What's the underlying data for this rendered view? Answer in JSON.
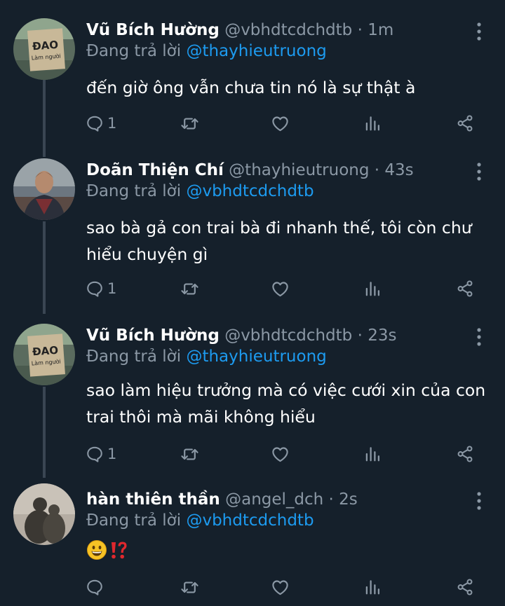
{
  "tweets": [
    {
      "name": "Vũ Bích Hường",
      "handle": "@vbhdtcdchdtb",
      "separator": "·",
      "time": "1m",
      "replying_label": "Đang trả lời",
      "replying_to": "@thayhieutruong",
      "text": "đến giờ ông vẫn chưa tin nó là sự thật à",
      "reply_count": "1",
      "avatar_sign_line1": "ĐAO",
      "avatar_sign_line2": "Làm người"
    },
    {
      "name": "Doãn Thiện Chí",
      "handle": "@thayhieutruong",
      "separator": "·",
      "time": "43s",
      "replying_label": "Đang trả lời",
      "replying_to": "@vbhdtcdchdtb",
      "text": "sao bà gả con trai bà đi nhanh thế, tôi còn chư hiểu chuyện gì",
      "reply_count": "1"
    },
    {
      "name": "Vũ Bích Hường",
      "handle": "@vbhdtcdchdtb",
      "separator": "·",
      "time": "23s",
      "replying_label": "Đang trả lời",
      "replying_to": "@thayhieutruong",
      "text": "sao làm hiệu trưởng mà có việc cưới xin của con trai thôi mà mãi không hiểu",
      "reply_count": "1",
      "avatar_sign_line1": "ĐAO",
      "avatar_sign_line2": "Làm người"
    },
    {
      "name": "hàn thiên thần",
      "handle": "@angel_dch",
      "separator": "·",
      "time": "2s",
      "replying_label": "Đang trả lời",
      "replying_to": "@vbhdtcdchdtb",
      "text": "",
      "reply_count": "",
      "emojis": [
        "grinning-face",
        "exclamation-question-mark"
      ]
    }
  ],
  "icons": {
    "reply": "speech-bubble-outline",
    "retweet": "retweet-arrows",
    "like": "heart-outline",
    "analytics": "bar-chart",
    "share": "share-nodes",
    "more": "vertical-ellipsis"
  },
  "colors": {
    "background": "#15202b",
    "name": "#ffffff",
    "muted": "#8b98a5",
    "mention": "#1d9bf0",
    "thread_line": "#3a4653"
  }
}
